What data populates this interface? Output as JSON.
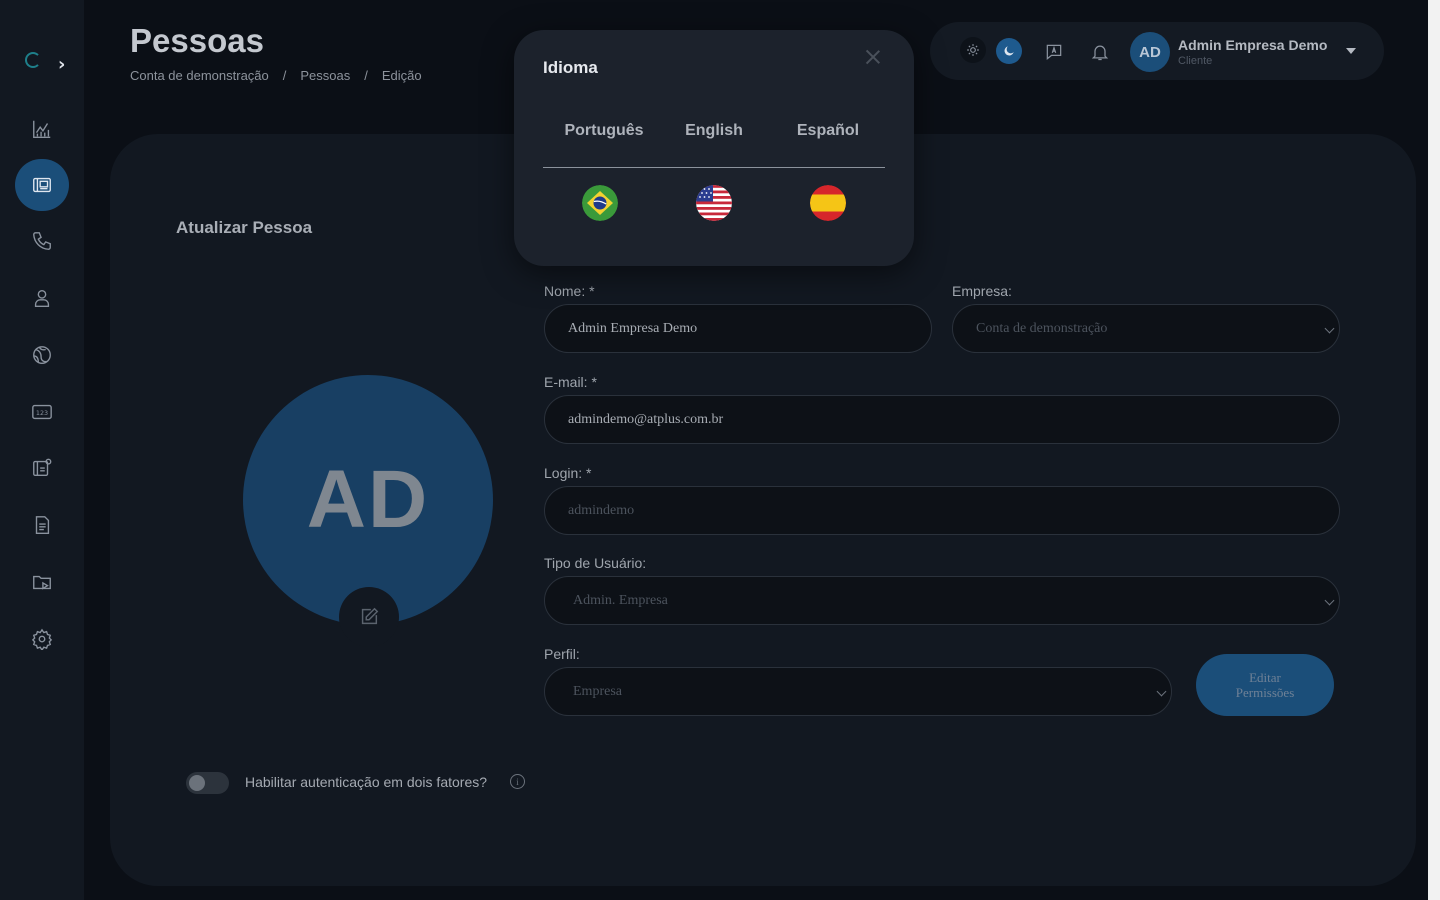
{
  "header": {
    "title": "Pessoas",
    "breadcrumb": [
      "Conta de demonstração",
      "Pessoas",
      "Edição"
    ],
    "breadcrumb_sep": "/"
  },
  "topbar": {
    "user_initials": "AD",
    "user_name": "Admin Empresa Demo",
    "user_role": "Cliente"
  },
  "sidebar": {
    "items": [
      {
        "name": "dashboard",
        "icon": "chart-icon"
      },
      {
        "name": "people",
        "icon": "people-card-icon",
        "active": true
      },
      {
        "name": "calls",
        "icon": "phone-icon"
      },
      {
        "name": "user",
        "icon": "user-icon"
      },
      {
        "name": "network",
        "icon": "globe-icon"
      },
      {
        "name": "numbers",
        "icon": "numbers-icon"
      },
      {
        "name": "contacts",
        "icon": "contact-card-icon"
      },
      {
        "name": "reports",
        "icon": "document-icon"
      },
      {
        "name": "media",
        "icon": "folder-play-icon"
      },
      {
        "name": "settings",
        "icon": "gear-icon"
      }
    ]
  },
  "form": {
    "title": "Atualizar Pessoa",
    "avatar_initials": "AD",
    "name_label": "Nome: *",
    "name_value": "Admin Empresa Demo",
    "company_label": "Empresa:",
    "company_value": "Conta de demonstração",
    "email_label": "E-mail: *",
    "email_value": "admindemo@atplus.com.br",
    "login_label": "Login: *",
    "login_value": "admindemo",
    "user_type_label": "Tipo de Usuário:",
    "user_type_value": "Admin. Empresa",
    "profile_label": "Perfil:",
    "profile_value": "Empresa",
    "permissions_button_line1": "Editar",
    "permissions_button_line2": "Permissões",
    "two_factor_label": "Habilitar autenticação em dois fatores?",
    "two_factor_enabled": false,
    "info_glyph": "i"
  },
  "language_modal": {
    "title": "Idioma",
    "languages": [
      {
        "label": "Português",
        "flag": "brazil-flag-icon"
      },
      {
        "label": "English",
        "flag": "usa-flag-icon"
      },
      {
        "label": "Español",
        "flag": "spain-flag-icon"
      }
    ]
  },
  "colors": {
    "accent": "#1b4e79",
    "background": "#0b0f16",
    "card": "#121821",
    "modal": "#1c222c"
  }
}
